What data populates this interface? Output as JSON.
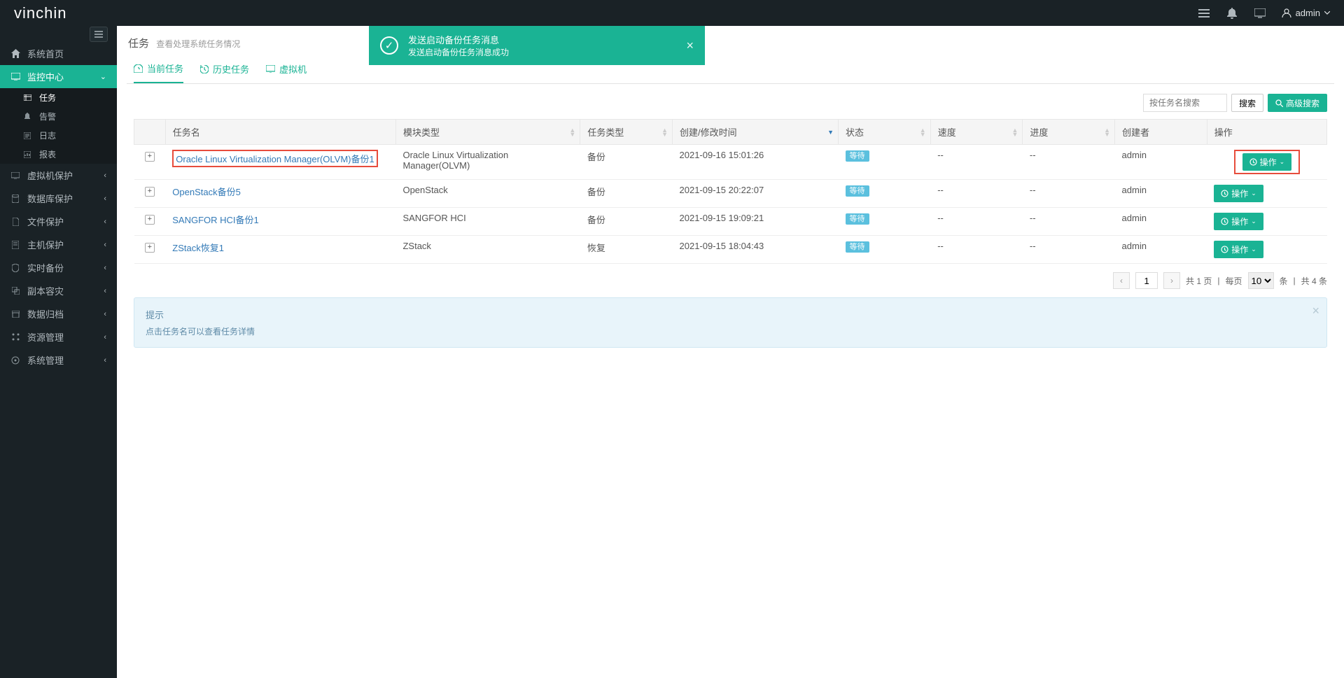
{
  "brand": "vinchin",
  "user": {
    "name": "admin"
  },
  "toast": {
    "title": "发送启动备份任务消息",
    "sub": "发送启动备份任务消息成功"
  },
  "page": {
    "title": "任务",
    "sub": "查看处理系统任务情况"
  },
  "tabs": {
    "current": "当前任务",
    "history": "历史任务",
    "vm": "虚拟机"
  },
  "sidebar": {
    "home": "系统首页",
    "monitor": "监控中心",
    "task": "任务",
    "alarm": "告警",
    "log": "日志",
    "report": "报表",
    "vm_protect": "虚拟机保护",
    "db_protect": "数据库保护",
    "file_protect": "文件保护",
    "host_protect": "主机保护",
    "realtime_backup": "实时备份",
    "replica_dr": "副本容灾",
    "data_archive": "数据归档",
    "resource_mgmt": "资源管理",
    "system_mgmt": "系统管理"
  },
  "search": {
    "placeholder": "按任务名搜索",
    "btn": "搜索",
    "adv": "高级搜索"
  },
  "columns": {
    "expand": "",
    "name": "任务名",
    "module": "模块类型",
    "type": "任务类型",
    "time": "创建/修改时间",
    "status": "状态",
    "speed": "速度",
    "progress": "进度",
    "creator": "创建者",
    "op": "操作"
  },
  "status_text": "等待",
  "op_text": "操作",
  "rows": [
    {
      "name": "Oracle Linux Virtualization Manager(OLVM)备份1",
      "module": "Oracle Linux Virtualization Manager(OLVM)",
      "type": "备份",
      "time": "2021-09-16 15:01:26",
      "speed": "--",
      "progress": "--",
      "creator": "admin",
      "highlight": true
    },
    {
      "name": "OpenStack备份5",
      "module": "OpenStack",
      "type": "备份",
      "time": "2021-09-15 20:22:07",
      "speed": "--",
      "progress": "--",
      "creator": "admin",
      "highlight": false
    },
    {
      "name": "SANGFOR HCI备份1",
      "module": "SANGFOR HCI",
      "type": "备份",
      "time": "2021-09-15 19:09:21",
      "speed": "--",
      "progress": "--",
      "creator": "admin",
      "highlight": false
    },
    {
      "name": "ZStack恢复1",
      "module": "ZStack",
      "type": "恢复",
      "time": "2021-09-15 18:04:43",
      "speed": "--",
      "progress": "--",
      "creator": "admin",
      "highlight": false
    }
  ],
  "pager": {
    "page": "1",
    "total_pages_label": "共 1 页",
    "per_page_label": "每页",
    "per_page": "10",
    "items_label": "条",
    "total_items_label": "共 4 条",
    "sep": "|"
  },
  "tip": {
    "title": "提示",
    "text": "点击任务名可以查看任务详情"
  }
}
